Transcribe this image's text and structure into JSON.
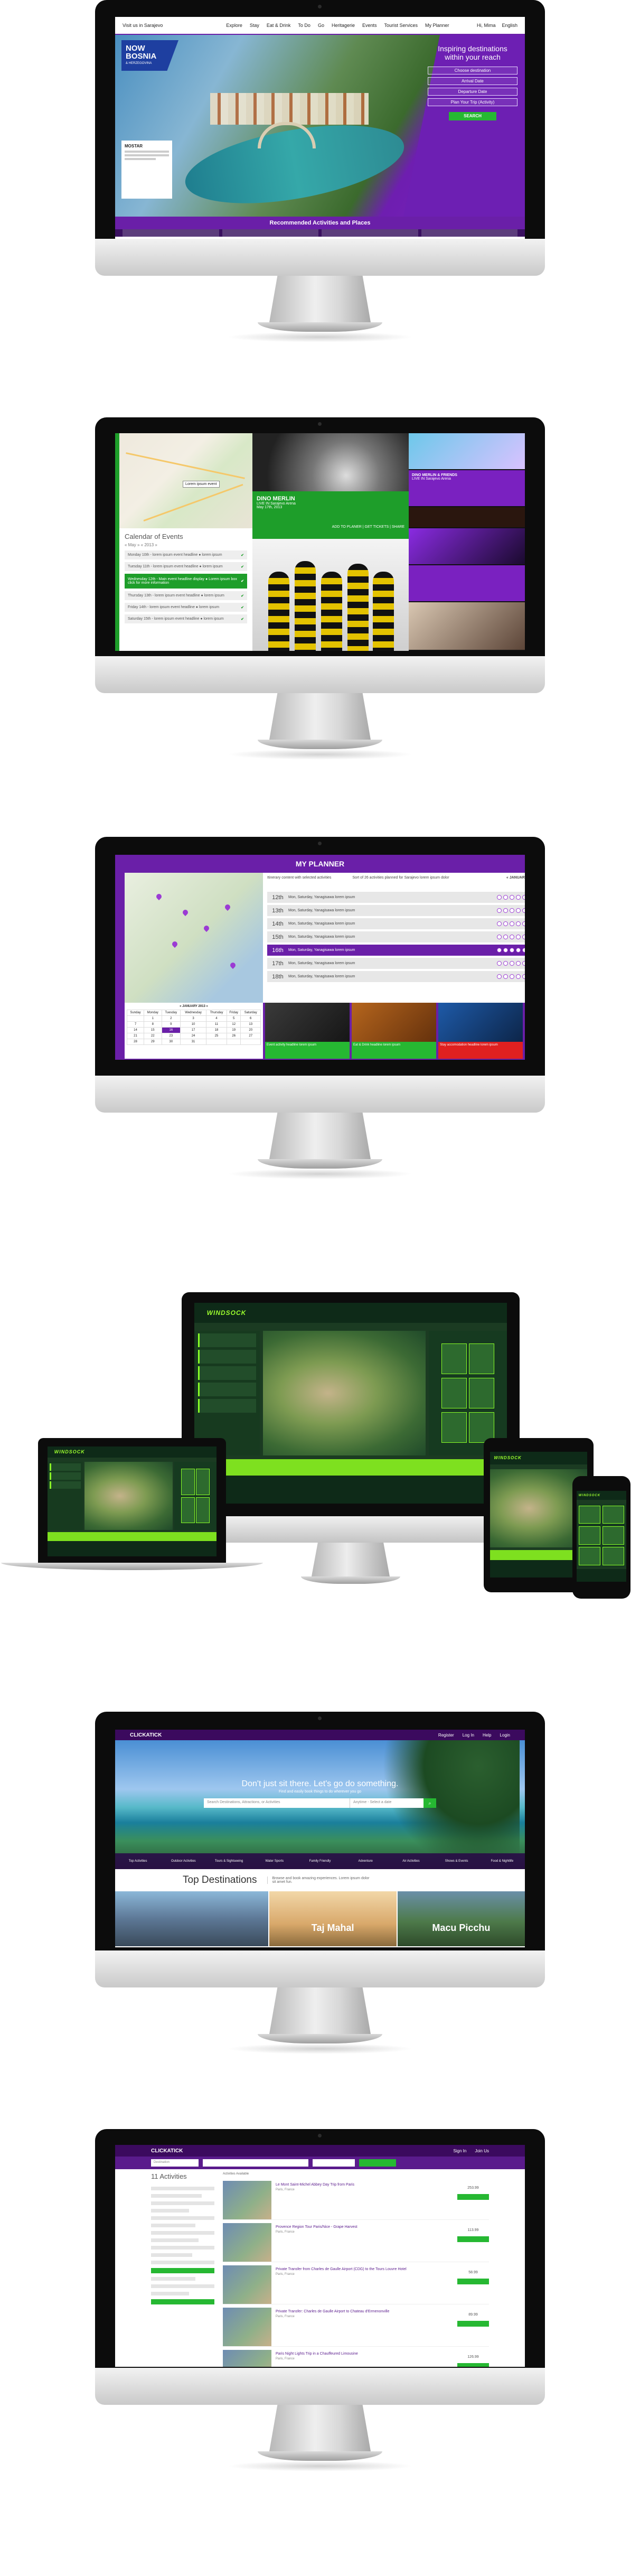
{
  "colors": {
    "purple": "#6a1fa8",
    "deep_purple": "#3b0a5e",
    "green": "#26b832",
    "dark_green": "#1e9e2a",
    "lime": "#8aff27",
    "bezel": "#0c0c0c"
  },
  "screen1": {
    "top_left": "Visit us in Sarajevo",
    "nav": [
      "Explore",
      "Stay",
      "Eat & Drink",
      "To Do",
      "Go",
      "Heritagerie",
      "Events",
      "Tourist Services",
      "My Planner"
    ],
    "user": "Hi, Mima",
    "language": "English",
    "logo_line1": "NOW",
    "logo_line2": "BOSNIA",
    "logo_tag": "& HERZEGOVINA",
    "info_title": "MOSTAR",
    "search_title_1": "Inspiring destinations",
    "search_title_2": "within your reach",
    "fields": [
      "Choose destination",
      "Arrival Date",
      "Departure Date",
      "Plan Your Trip (Activity)"
    ],
    "search_button": "SEARCH",
    "bar_title": "Recommended Activities and Places"
  },
  "screen2": {
    "map_tip": "Lorem ipsum event",
    "cal_title": "Calendar of Events",
    "cal_month": "« May »    « 2013 »",
    "rows": [
      "Monday 10th - lorem ipsum event headline ● lorem ipsum",
      "Tuesday 11th - lorem ipsum event headline ● lorem ipsum",
      "Wednesday 12th - Main event headline display ● Lorem ipsum box click for more information",
      "Thursday 13th - lorem ipsum event headline ● lorem ipsum",
      "Friday 14th - lorem ipsum event headline ● lorem ipsum",
      "Saturday 15th - lorem ipsum event headline ● lorem ipsum"
    ],
    "highlight_row": 2,
    "event_title": "DINO MERLIN",
    "event_sub": "LIVE IN Sarajevo Arena",
    "event_date": "May 17th, 2013",
    "event_link1": "ADD TO PLANER",
    "event_link2": "GET TICKETS",
    "event_link3": "SHARE",
    "right_tile1": "DINO MERLIN & FRIENDS",
    "right_tile2": "LIVE IN Sarajevo Arena"
  },
  "screen3": {
    "title": "MY PLANNER",
    "head1": "Itinerary content with selected activities",
    "head2": "Sort of 26 activities planned for Sarajevo lorem ipsum dolor",
    "month": "« JANUARY »",
    "day_plan": "DAY PLAN",
    "days": [
      {
        "day": "12th",
        "text": "Mon, Saturday, Yanagisawa lorem ipsum"
      },
      {
        "day": "13th",
        "text": "Mon, Saturday, Yanagisawa lorem ipsum"
      },
      {
        "day": "14th",
        "text": "Mon, Saturday, Yanagisawa lorem ipsum"
      },
      {
        "day": "15th",
        "text": "Mon, Saturday, Yanagisawa lorem ipsum"
      },
      {
        "day": "16th",
        "text": "Mon, Saturday, Yanagisawa lorem ipsum"
      },
      {
        "day": "17th",
        "text": "Mon, Saturday, Yanagisawa lorem ipsum"
      },
      {
        "day": "18th",
        "text": "Mon, Saturday, Yanagisawa lorem ipsum"
      }
    ],
    "active_day": 4,
    "cal_month": "« JANUARY 2013 »",
    "cal_days": [
      "Sunday",
      "Monday",
      "Tuesday",
      "Wednesday",
      "Thursday",
      "Friday",
      "Saturday"
    ],
    "cal_weeks": [
      [
        "",
        "1",
        "2",
        "3",
        "4",
        "5",
        "6"
      ],
      [
        "7",
        "8",
        "9",
        "10",
        "11",
        "12",
        "13"
      ],
      [
        "14",
        "15",
        "16",
        "17",
        "18",
        "19",
        "20"
      ],
      [
        "21",
        "22",
        "23",
        "24",
        "25",
        "26",
        "27"
      ],
      [
        "28",
        "29",
        "30",
        "31",
        "",
        "",
        ""
      ]
    ],
    "selected_date": "16",
    "tiles": [
      {
        "cap": "Event activity headline lorem ipsum",
        "color": "#26b832"
      },
      {
        "cap": "Eat & Drink headline lorem ipsum",
        "color": "#26b832"
      },
      {
        "cap": "Stay accomodation headline lorem ipsum",
        "color": "#e02020"
      }
    ]
  },
  "screen4": {
    "logo": "WINDSOCK"
  },
  "screen5": {
    "logo": "CLICKATICK",
    "links": [
      "Register",
      "Log In",
      "Help",
      "Login"
    ],
    "headline": "Don't just sit there. Let's go do something.",
    "subline": "Find and easily book things to do wherever you go",
    "search_placeholder": "Search Destinations, Attractions, or Activities",
    "date_placeholder": "Anytime - Select a date",
    "categories": [
      "Top Activities",
      "Outdoor Activities",
      "Tours & Sightseeing",
      "Water Sports",
      "Family Friendly",
      "Adventure",
      "Air Activities",
      "Shows & Events",
      "Food & Nightlife"
    ],
    "dest_title": "Top Destinations",
    "dest_desc": "Browse and book amazing experiences. Lorem ipsum dolor sit amet fun.",
    "destinations": [
      "",
      "Taj Mahal",
      "Macu Picchu"
    ]
  },
  "screen6": {
    "logo": "CLICKATICK",
    "links": [
      "Sign In",
      "Join Us"
    ],
    "search_placeholder": "Destination",
    "activities_title": "11 Activities",
    "list_header": "Activities Available",
    "results": [
      {
        "title": "Le Mont Saint-Michel Abbey Day Trip from Paris",
        "sub": "Paris, France",
        "price": "253.99"
      },
      {
        "title": "Provence Region Tour Paris/Nice - Grape Harvest",
        "sub": "Paris, France",
        "price": "113.99"
      },
      {
        "title": "Private Transfer from Charles de Gaulle Airport (CDG) to the Tours Louvre Hotel",
        "sub": "Paris, France",
        "price": "58.99"
      },
      {
        "title": "Private Transfer: Charles de Gaulle Airport to Chateau d'Ermenonville",
        "sub": "Paris, France",
        "price": "89.99"
      },
      {
        "title": "Paris Night Lights Trip in a Chauffeured Limousine",
        "sub": "Paris, France",
        "price": "126.99"
      }
    ]
  }
}
